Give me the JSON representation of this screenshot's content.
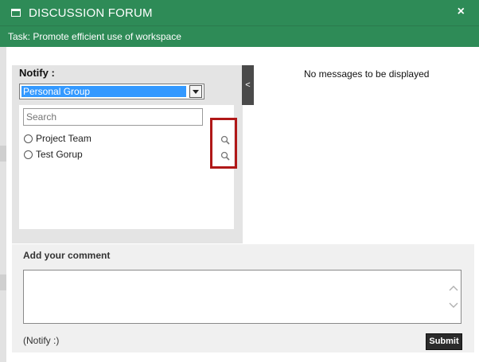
{
  "dialog": {
    "title": "DISCUSSION FORUM",
    "close_label": "×",
    "task": "Task: Promote efficient use of workspace"
  },
  "notify": {
    "label": "Notify :",
    "selected_group": "Personal Group",
    "search_placeholder": "Search",
    "items": [
      {
        "label": "Project Team"
      },
      {
        "label": "Test Gorup"
      }
    ]
  },
  "collapse_label": "<",
  "messages": {
    "empty_text": "No messages to be displayed"
  },
  "comment": {
    "label": "Add your comment",
    "value": "",
    "notify_note": "(Notify :)",
    "submit_label": "Submit"
  },
  "colors": {
    "header_green": "#2e8b57",
    "select_highlight": "#3399ff",
    "highlight_box": "#b01818",
    "submit_bg": "#2b2b2b"
  },
  "icons": [
    "window-icon",
    "close-icon",
    "search-icon",
    "scroll-up-icon",
    "scroll-down-icon"
  ]
}
